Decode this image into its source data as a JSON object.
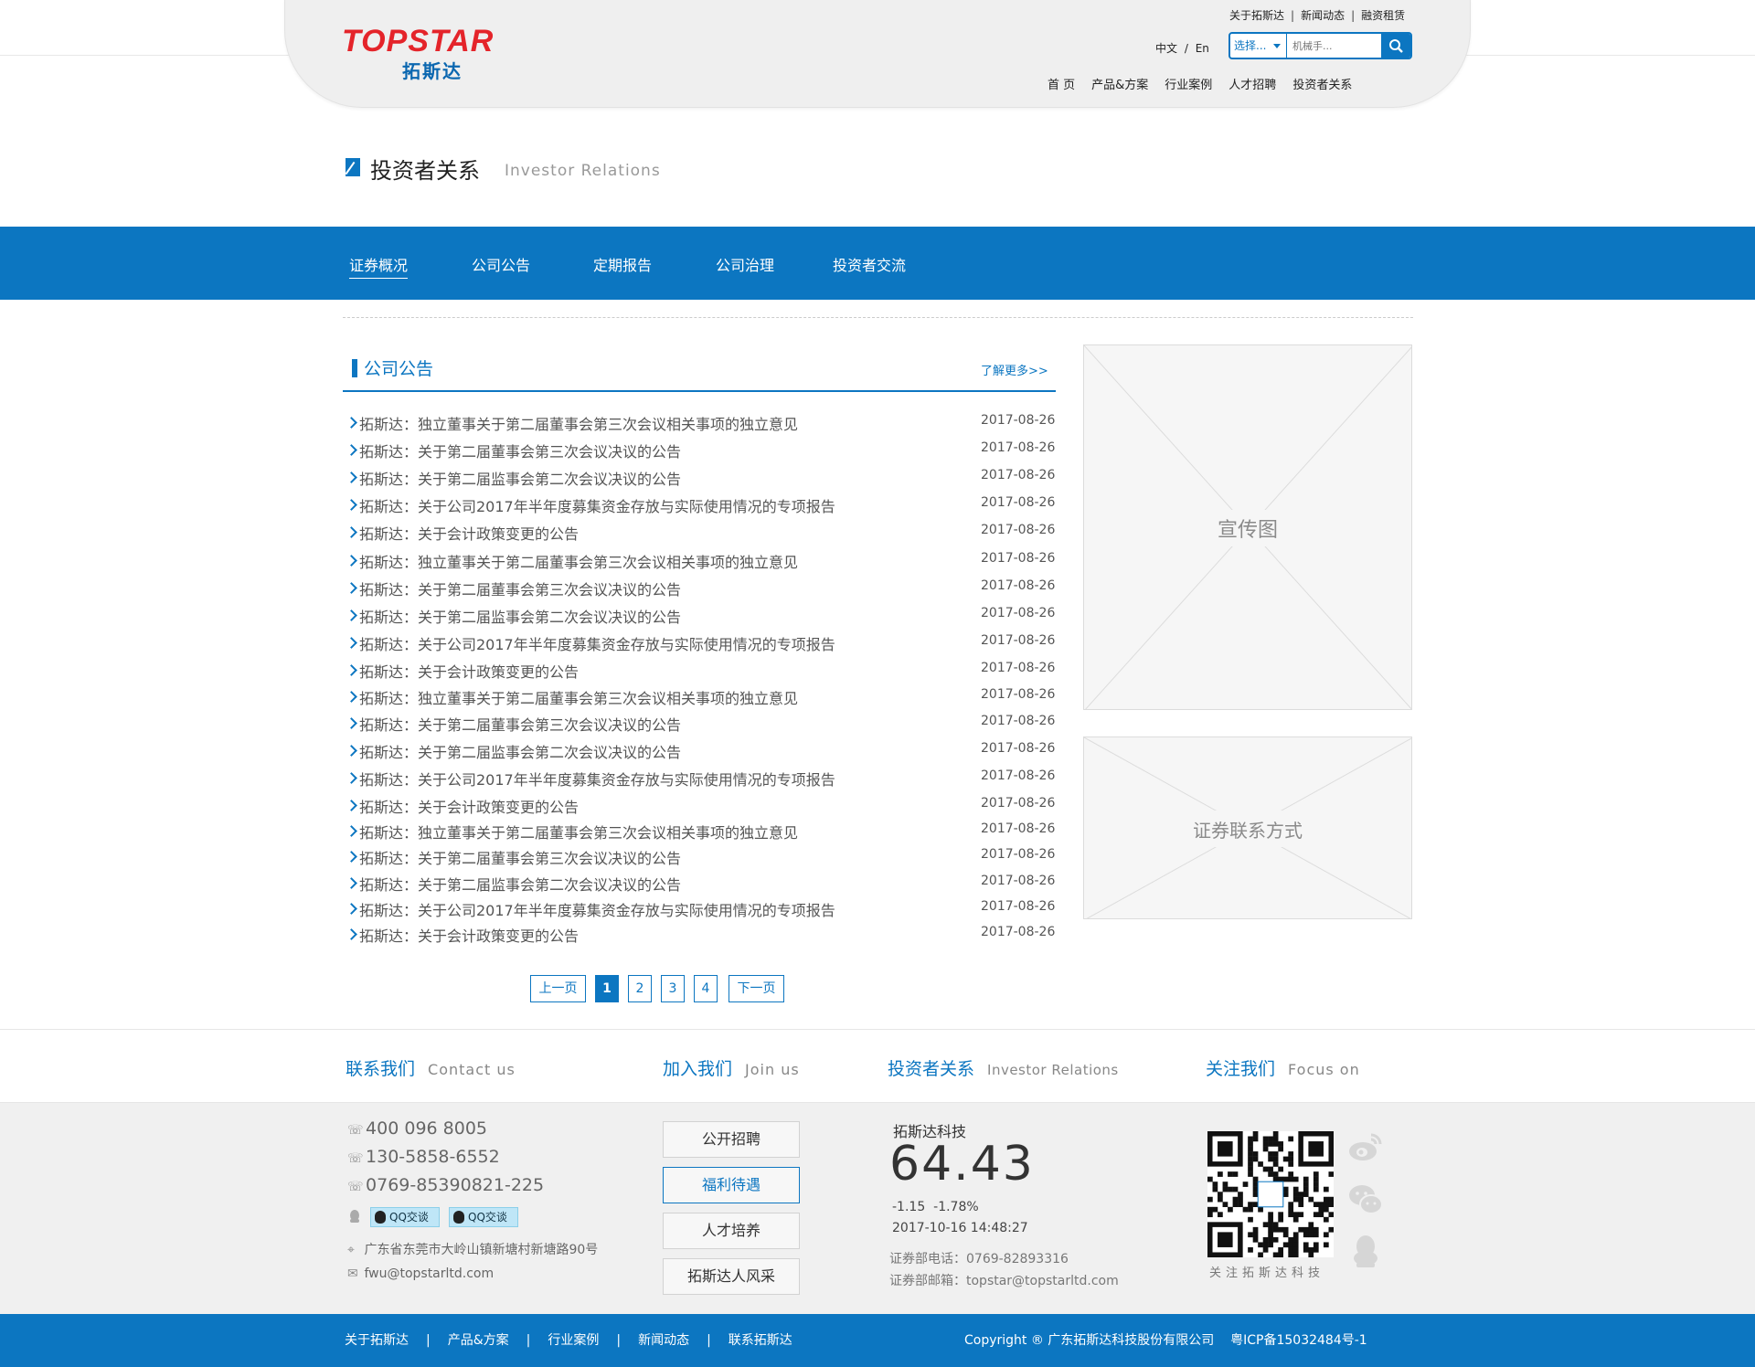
{
  "header": {
    "logo_en": "TOPSTAR",
    "logo_cn": "拓斯达",
    "top_links": [
      "关于拓斯达",
      "新闻动态",
      "融资租赁"
    ],
    "lang_cn": "中文",
    "lang_sep": "/",
    "lang_en": "En",
    "search_select": "选择...",
    "search_placeholder": "机械手...",
    "nav": [
      "首 页",
      "产品&方案",
      "行业案例",
      "人才招聘",
      "投资者关系"
    ]
  },
  "page_title": {
    "cn": "投资者关系",
    "en": "Investor Relations"
  },
  "subnav": {
    "items": [
      "证券概况",
      "公司公告",
      "定期报告",
      "公司治理",
      "投资者交流"
    ],
    "active": 0
  },
  "notices": {
    "title": "公司公告",
    "more": "了解更多>>",
    "items": [
      {
        "title": "拓斯达：独立董事关于第二届董事会第三次会议相关事项的独立意见",
        "date": "2017-08-26"
      },
      {
        "title": "拓斯达：关于第二届董事会第三次会议决议的公告",
        "date": "2017-08-26"
      },
      {
        "title": "拓斯达：关于第二届监事会第二次会议决议的公告",
        "date": "2017-08-26"
      },
      {
        "title": "拓斯达：关于公司2017年半年度募集资金存放与实际使用情况的专项报告",
        "date": "2017-08-26"
      },
      {
        "title": "拓斯达：关于会计政策变更的公告",
        "date": "2017-08-26"
      },
      {
        "title": "拓斯达：独立董事关于第二届董事会第三次会议相关事项的独立意见",
        "date": "2017-08-26"
      },
      {
        "title": "拓斯达：关于第二届董事会第三次会议决议的公告",
        "date": "2017-08-26"
      },
      {
        "title": "拓斯达：关于第二届监事会第二次会议决议的公告",
        "date": "2017-08-26"
      },
      {
        "title": "拓斯达：关于公司2017年半年度募集资金存放与实际使用情况的专项报告",
        "date": "2017-08-26"
      },
      {
        "title": "拓斯达：关于会计政策变更的公告",
        "date": "2017-08-26"
      },
      {
        "title": "拓斯达：独立董事关于第二届董事会第三次会议相关事项的独立意见",
        "date": "2017-08-26"
      },
      {
        "title": "拓斯达：关于第二届董事会第三次会议决议的公告",
        "date": "2017-08-26"
      },
      {
        "title": "拓斯达：关于第二届监事会第二次会议决议的公告",
        "date": "2017-08-26"
      },
      {
        "title": "拓斯达：关于公司2017年半年度募集资金存放与实际使用情况的专项报告",
        "date": "2017-08-26"
      },
      {
        "title": "拓斯达：关于会计政策变更的公告",
        "date": "2017-08-26"
      },
      {
        "title": "拓斯达：独立董事关于第二届董事会第三次会议相关事项的独立意见",
        "date": "2017-08-26"
      },
      {
        "title": "拓斯达：关于第二届董事会第三次会议决议的公告",
        "date": "2017-08-26"
      },
      {
        "title": "拓斯达：关于第二届监事会第二次会议决议的公告",
        "date": "2017-08-26"
      },
      {
        "title": "拓斯达：关于公司2017年半年度募集资金存放与实际使用情况的专项报告",
        "date": "2017-08-26"
      },
      {
        "title": "拓斯达：关于会计政策变更的公告",
        "date": "2017-08-26"
      }
    ]
  },
  "pager": {
    "prev": "上一页",
    "pages": [
      "1",
      "2",
      "3",
      "4"
    ],
    "current": "1",
    "next": "下一页"
  },
  "sidebar": {
    "banner": "宣传图",
    "contact": "证券联系方式"
  },
  "footer": {
    "headings": [
      {
        "cn": "联系我们",
        "en": "Contact us"
      },
      {
        "cn": "加入我们",
        "en": "Join us"
      },
      {
        "cn": "投资者关系",
        "en": "Investor Relations"
      },
      {
        "cn": "关注我们",
        "en": "Focus on"
      }
    ],
    "contact": {
      "phone1": "400 096 8005",
      "phone2": "130-5858-6552",
      "phone3": "0769-85390821-225",
      "qq_label": "QQ交谈",
      "address": "广东省东莞市大岭山镇新塘村新塘路90号",
      "email": "fwu@topstarltd.com"
    },
    "join": {
      "items": [
        "公开招聘",
        "福利待遇",
        "人才培养",
        "拓斯达人风采"
      ],
      "active": 1
    },
    "stock": {
      "name": "拓斯达科技",
      "price": "64.43",
      "change": "-1.15",
      "change_pct": "-1.78%",
      "time": "2017-10-16 14:48:27",
      "phone": "证券部电话：0769-82893316",
      "email": "证券部邮箱：topstar@topstarltd.com"
    },
    "follow_label": "关注拓斯达科技",
    "social_icons": [
      "weibo-icon",
      "wechat-icon",
      "qq-icon"
    ],
    "links": [
      "关于拓斯达",
      "产品&方案",
      "行业案例",
      "新闻动态",
      "联系拓斯达"
    ],
    "copyright": "Copyright ® 广东拓斯达科技股份有限公司",
    "icp": "粤ICP备15032484号-1"
  },
  "colors": {
    "brand_blue": "#0c76c1",
    "logo_red": "#e4242a"
  }
}
